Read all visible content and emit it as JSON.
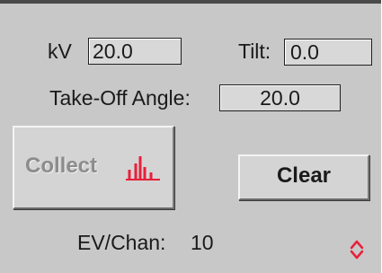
{
  "params": {
    "kv_label": "kV",
    "kv_value": "20.0",
    "tilt_label": "Tilt:",
    "tilt_value": "0.0",
    "takeoff_label": "Take-Off Angle:",
    "takeoff_value": "20.0"
  },
  "buttons": {
    "collect_label": "Collect",
    "collect_icon": "spectrum-peaks-icon",
    "clear_label": "Clear"
  },
  "status": {
    "ev_chan_label": "EV/Chan:",
    "ev_chan_value": "10",
    "toggle_icon": "up-down-chevron-icon"
  },
  "colors": {
    "panel_bg": "#c8c8c8",
    "accent_red": "#e8203a",
    "disabled_text": "#8c8c8c"
  }
}
